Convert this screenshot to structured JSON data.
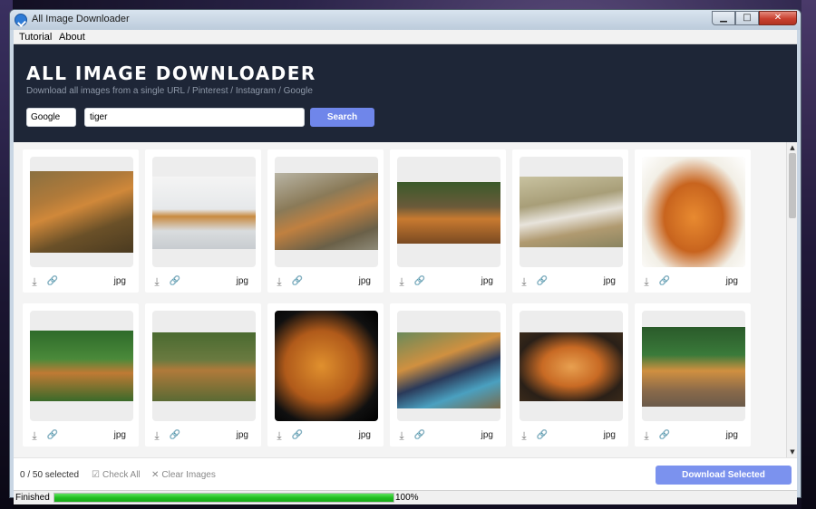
{
  "window": {
    "title": "All Image Downloader"
  },
  "window_controls": {
    "minimize": "▁",
    "maximize": "□",
    "close": "✕"
  },
  "menu": [
    {
      "label": "Tutorial"
    },
    {
      "label": "About"
    }
  ],
  "header": {
    "title": "ALL IMAGE DOWNLOADER",
    "subtitle": "Download all images from a single URL / Pinterest / Instagram / Google"
  },
  "search": {
    "source": "Google",
    "query": "tiger",
    "button_label": "Search"
  },
  "icons": {
    "download": "download-icon",
    "link": "link-icon"
  },
  "images": [
    {
      "format": "jpg"
    },
    {
      "format": "jpg"
    },
    {
      "format": "jpg"
    },
    {
      "format": "jpg"
    },
    {
      "format": "jpg"
    },
    {
      "format": "jpg"
    },
    {
      "format": "jpg"
    },
    {
      "format": "jpg"
    },
    {
      "format": "jpg"
    },
    {
      "format": "jpg"
    },
    {
      "format": "jpg"
    },
    {
      "format": "jpg"
    }
  ],
  "footer": {
    "selected_count": "0 / 50 selected",
    "check_all": "Check All",
    "clear_images": "Clear Images",
    "download_selected": "Download Selected"
  },
  "status": {
    "text": "Finished",
    "progress_percent": 100,
    "progress_label": "100%"
  },
  "colors": {
    "header_bg": "#1e2637",
    "accent": "#6f86ea",
    "progress": "#23c023"
  }
}
